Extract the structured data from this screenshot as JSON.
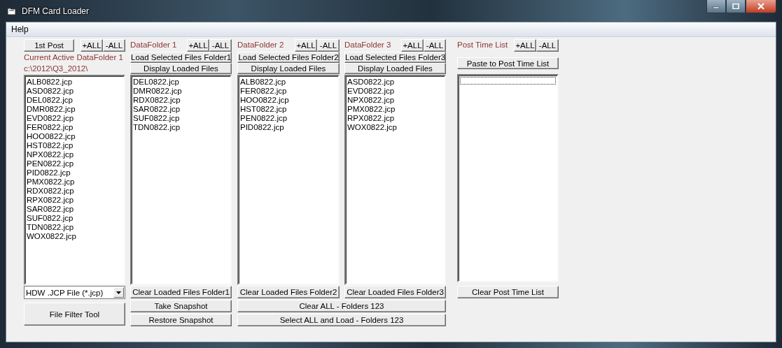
{
  "window": {
    "title": "DFM Card Loader"
  },
  "menu": [
    {
      "label": "Help"
    }
  ],
  "main": {
    "post_button": "1st Post",
    "plus_all": "+ALL",
    "minus_all": "-ALL",
    "active_label": "Current Active DataFolder 1",
    "path": "c:\\2012\\Q3_2012\\",
    "files": [
      "ALB0822.jcp",
      "ASD0822.jcp",
      "DEL0822.jcp",
      "DMR0822.jcp",
      "EVD0822.jcp",
      "FER0822.jcp",
      "HOO0822.jcp",
      "HST0822.jcp",
      "NPX0822.jcp",
      "PEN0822.jcp",
      "PID0822.jcp",
      "PMX0822.jcp",
      "RDX0822.jcp",
      "RPX0822.jcp",
      "SAR0822.jcp",
      "SUF0822.jcp",
      "TDN0822.jcp",
      "WOX0822.jcp"
    ],
    "filter": "HDW .JCP File (*.jcp)",
    "filter_button": "File Filter Tool"
  },
  "folders": [
    {
      "title": "DataFolder 1",
      "plus_all": "+ALL",
      "minus_all": "-ALL",
      "load_button": "Load Selected Files Folder1",
      "display_button": "Display Loaded Files",
      "files": [
        "DEL0822.jcp",
        "DMR0822.jcp",
        "RDX0822.jcp",
        "SAR0822.jcp",
        "SUF0822.jcp",
        "TDN0822.jcp"
      ],
      "clear_button": "Clear Loaded Files Folder1"
    },
    {
      "title": "DataFolder 2",
      "plus_all": "+ALL",
      "minus_all": "-ALL",
      "load_button": "Load Selected Files Folder2",
      "display_button": "Display Loaded Files",
      "files": [
        "ALB0822.jcp",
        "FER0822.jcp",
        "HOO0822.jcp",
        "HST0822.jcp",
        "PEN0822.jcp",
        "PID0822.jcp"
      ],
      "clear_button": "Clear Loaded Files Folder2"
    },
    {
      "title": "DataFolder 3",
      "plus_all": "+ALL",
      "minus_all": "-ALL",
      "load_button": "Load Selected Files Folder3",
      "display_button": "Display Loaded Files",
      "files": [
        "ASD0822.jcp",
        "EVD0822.jcp",
        "NPX0822.jcp",
        "PMX0822.jcp",
        "RPX0822.jcp",
        "WOX0822.jcp"
      ],
      "clear_button": "Clear Loaded Files Folder3"
    }
  ],
  "post_time": {
    "title": "Post Time List",
    "plus_all": "+ALL",
    "minus_all": "-ALL",
    "paste_button": "Paste to Post Time List",
    "focused": true,
    "clear_button": "Clear Post Time List"
  },
  "snapshot": {
    "take_button": "Take Snapshot",
    "restore_button": "Restore Snapshot"
  },
  "bulk": {
    "clear_all_button": "Clear ALL - Folders 123",
    "select_all_button": "Select ALL and Load - Folders 123"
  }
}
